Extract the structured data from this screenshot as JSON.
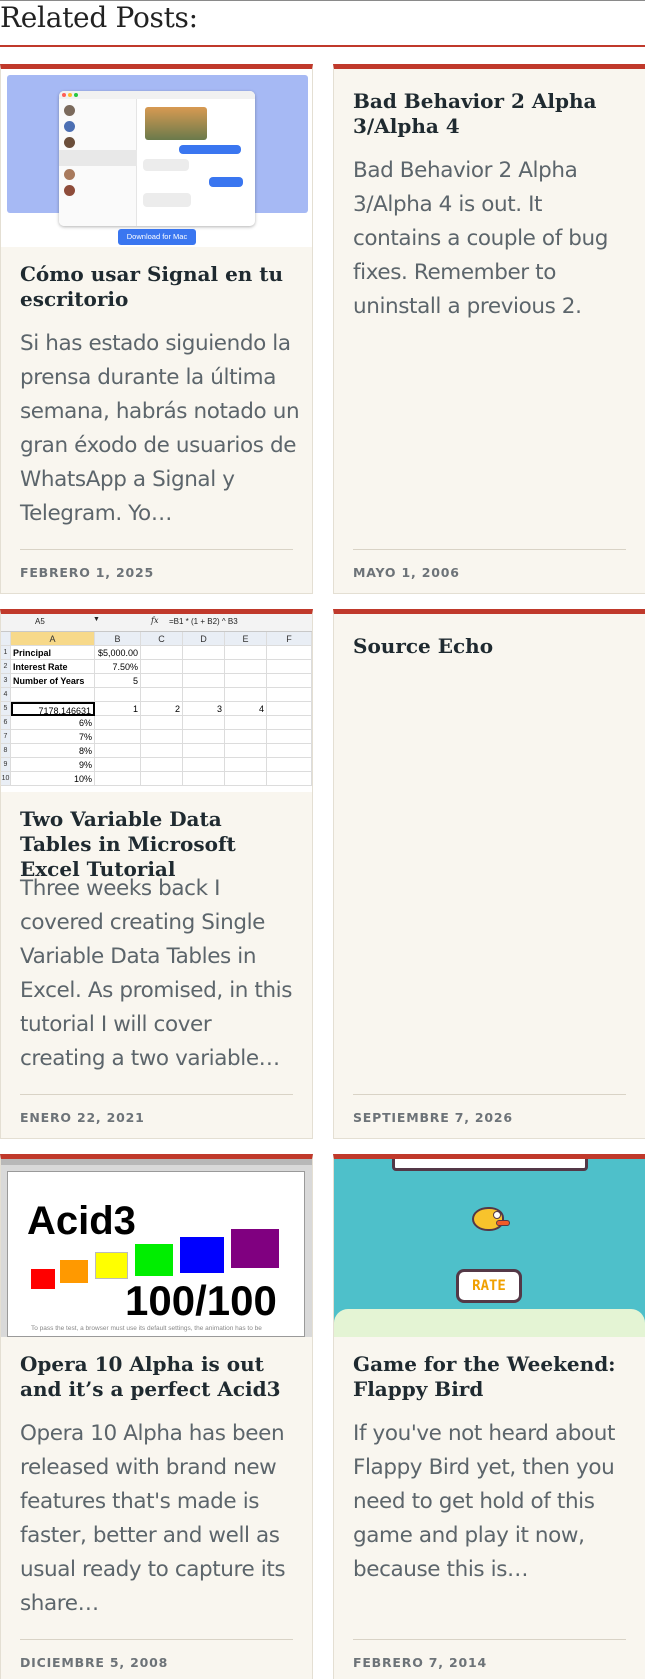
{
  "section": {
    "title": "Related Posts:"
  },
  "posts": [
    {
      "title": "Cómo usar Signal en tu escritorio",
      "excerpt": "Si has estado siguiendo la prensa durante la última semana, habrás notado un gran éxodo de usuarios de WhatsApp a Signal y Telegram. Yo…",
      "date": "FEBRERO 1, 2025",
      "thumb_caption": "Download for Mac"
    },
    {
      "title": "Bad Behavior 2 Alpha 3/Alpha 4",
      "excerpt": "Bad Behavior 2 Alpha 3/Alpha 4 is out. It contains a couple of bug fixes. Remember to uninstall a previous 2.",
      "date": "MAYO 1, 2006"
    },
    {
      "title": "Two Variable Data Tables in Microsoft Excel Tutorial",
      "excerpt": "Three weeks back I covered creating Single Variable Data Tables in Excel. As promised, in this tutorial I will cover creating a two variable…",
      "date": "ENERO 22, 2021",
      "thumb_excel": {
        "name_box": "A5",
        "formula": "=B1 * (1 + B2) ^ B3",
        "columns": [
          "A",
          "B",
          "C",
          "D",
          "E",
          "F"
        ],
        "rows": [
          [
            "1",
            "Principal",
            "$5,000.00",
            "",
            "",
            "",
            ""
          ],
          [
            "2",
            "Interest Rate",
            "7.50%",
            "",
            "",
            "",
            ""
          ],
          [
            "3",
            "Number of Years",
            "5",
            "",
            "",
            "",
            ""
          ],
          [
            "4",
            "",
            "",
            "",
            "",
            "",
            ""
          ],
          [
            "5",
            "7178.146631",
            "1",
            "2",
            "3",
            "4",
            ""
          ],
          [
            "6",
            "6%",
            "",
            "",
            "",
            "",
            ""
          ],
          [
            "7",
            "7%",
            "",
            "",
            "",
            "",
            ""
          ],
          [
            "8",
            "8%",
            "",
            "",
            "",
            "",
            ""
          ],
          [
            "9",
            "9%",
            "",
            "",
            "",
            "",
            ""
          ],
          [
            "10",
            "10%",
            "",
            "",
            "",
            "",
            ""
          ]
        ]
      }
    },
    {
      "title": "Source Echo",
      "excerpt": "",
      "date": "SEPTIEMBRE 7, 2026"
    },
    {
      "title": "Opera 10 Alpha is out and it’s a perfect Acid3",
      "excerpt": "Opera 10 Alpha has been released with brand new features that's made is faster, better and well as usual ready to capture its share…",
      "date": "DICIEMBRE 5, 2008",
      "thumb_acid": {
        "label": "Acid3",
        "score": "100/100",
        "footnote": "To pass the test, a browser must use its default settings, the animation has to be"
      }
    },
    {
      "title": "Game for the Weekend: Flappy Bird",
      "excerpt": "If you've not heard about Flappy Bird yet, then you need to get hold of this game and play it now, because this is…",
      "date": "FEBRERO 7, 2014",
      "thumb_flappy": {
        "button": "RATE"
      }
    }
  ],
  "colors": {
    "accent": "#c0392b",
    "card_bg": "#f9f6ef"
  }
}
